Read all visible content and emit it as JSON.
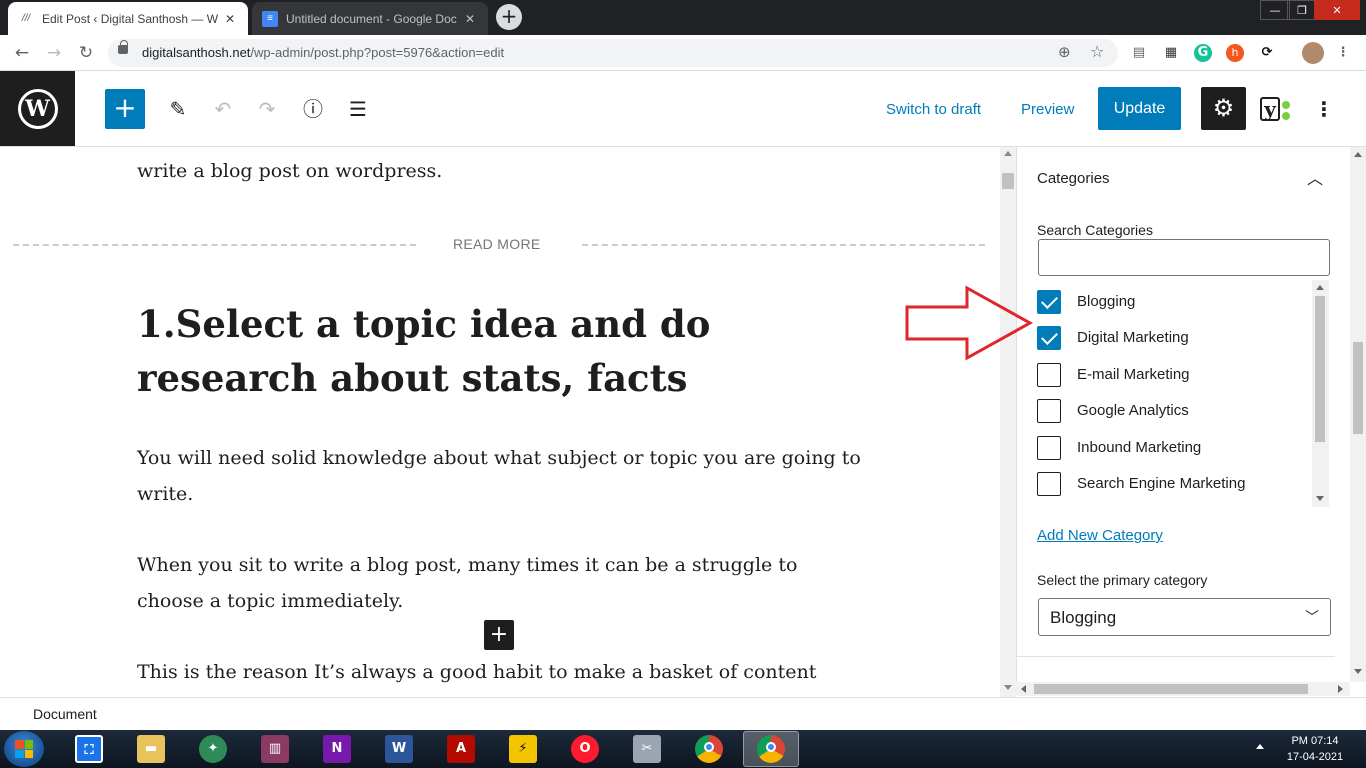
{
  "browser": {
    "tabs": [
      {
        "title": "Edit Post ‹ Digital Santhosh — W",
        "active": true
      },
      {
        "title": "Untitled document - Google Doc",
        "active": false
      }
    ],
    "url_host": "digitalsanthosh.net",
    "url_path": "/wp-admin/post.php?post=5976&action=edit",
    "window_controls": {
      "minimize": "—",
      "maximize": "❐",
      "close": "✕"
    }
  },
  "header": {
    "switch_to_draft": "Switch to draft",
    "preview": "Preview",
    "update": "Update",
    "colors": {
      "primary": "#007cba",
      "dark": "#1e1e1e"
    }
  },
  "editor": {
    "intro_tail": "write a blog post on wordpress.",
    "read_more": "READ MORE",
    "heading": "1.Select a topic idea and do research about stats, facts",
    "paragraphs": [
      "You will need solid knowledge about what subject or topic you are going to write.",
      "When you sit to write a blog post, many times it can be a struggle to choose a topic immediately.",
      "This is the reason It’s always a good habit to make a basket of content ideas."
    ]
  },
  "sidebar": {
    "panel_title": "Categories",
    "search_label": "Search Categories",
    "search_value": "",
    "categories": [
      {
        "label": "Blogging",
        "checked": true
      },
      {
        "label": "Digital Marketing",
        "checked": true
      },
      {
        "label": "E-mail Marketing",
        "checked": false
      },
      {
        "label": "Google Analytics",
        "checked": false
      },
      {
        "label": "Inbound Marketing",
        "checked": false
      },
      {
        "label": "Search Engine Marketing",
        "checked": false
      }
    ],
    "add_new": "Add New Category",
    "primary_label": "Select the primary category",
    "primary_value": "Blogging"
  },
  "annotation": {
    "arrow_color": "#e0262b"
  },
  "footer": {
    "breadcrumb": "Document"
  },
  "taskbar": {
    "clock_time": "PM 07:14",
    "clock_date": "17-04-2021"
  }
}
